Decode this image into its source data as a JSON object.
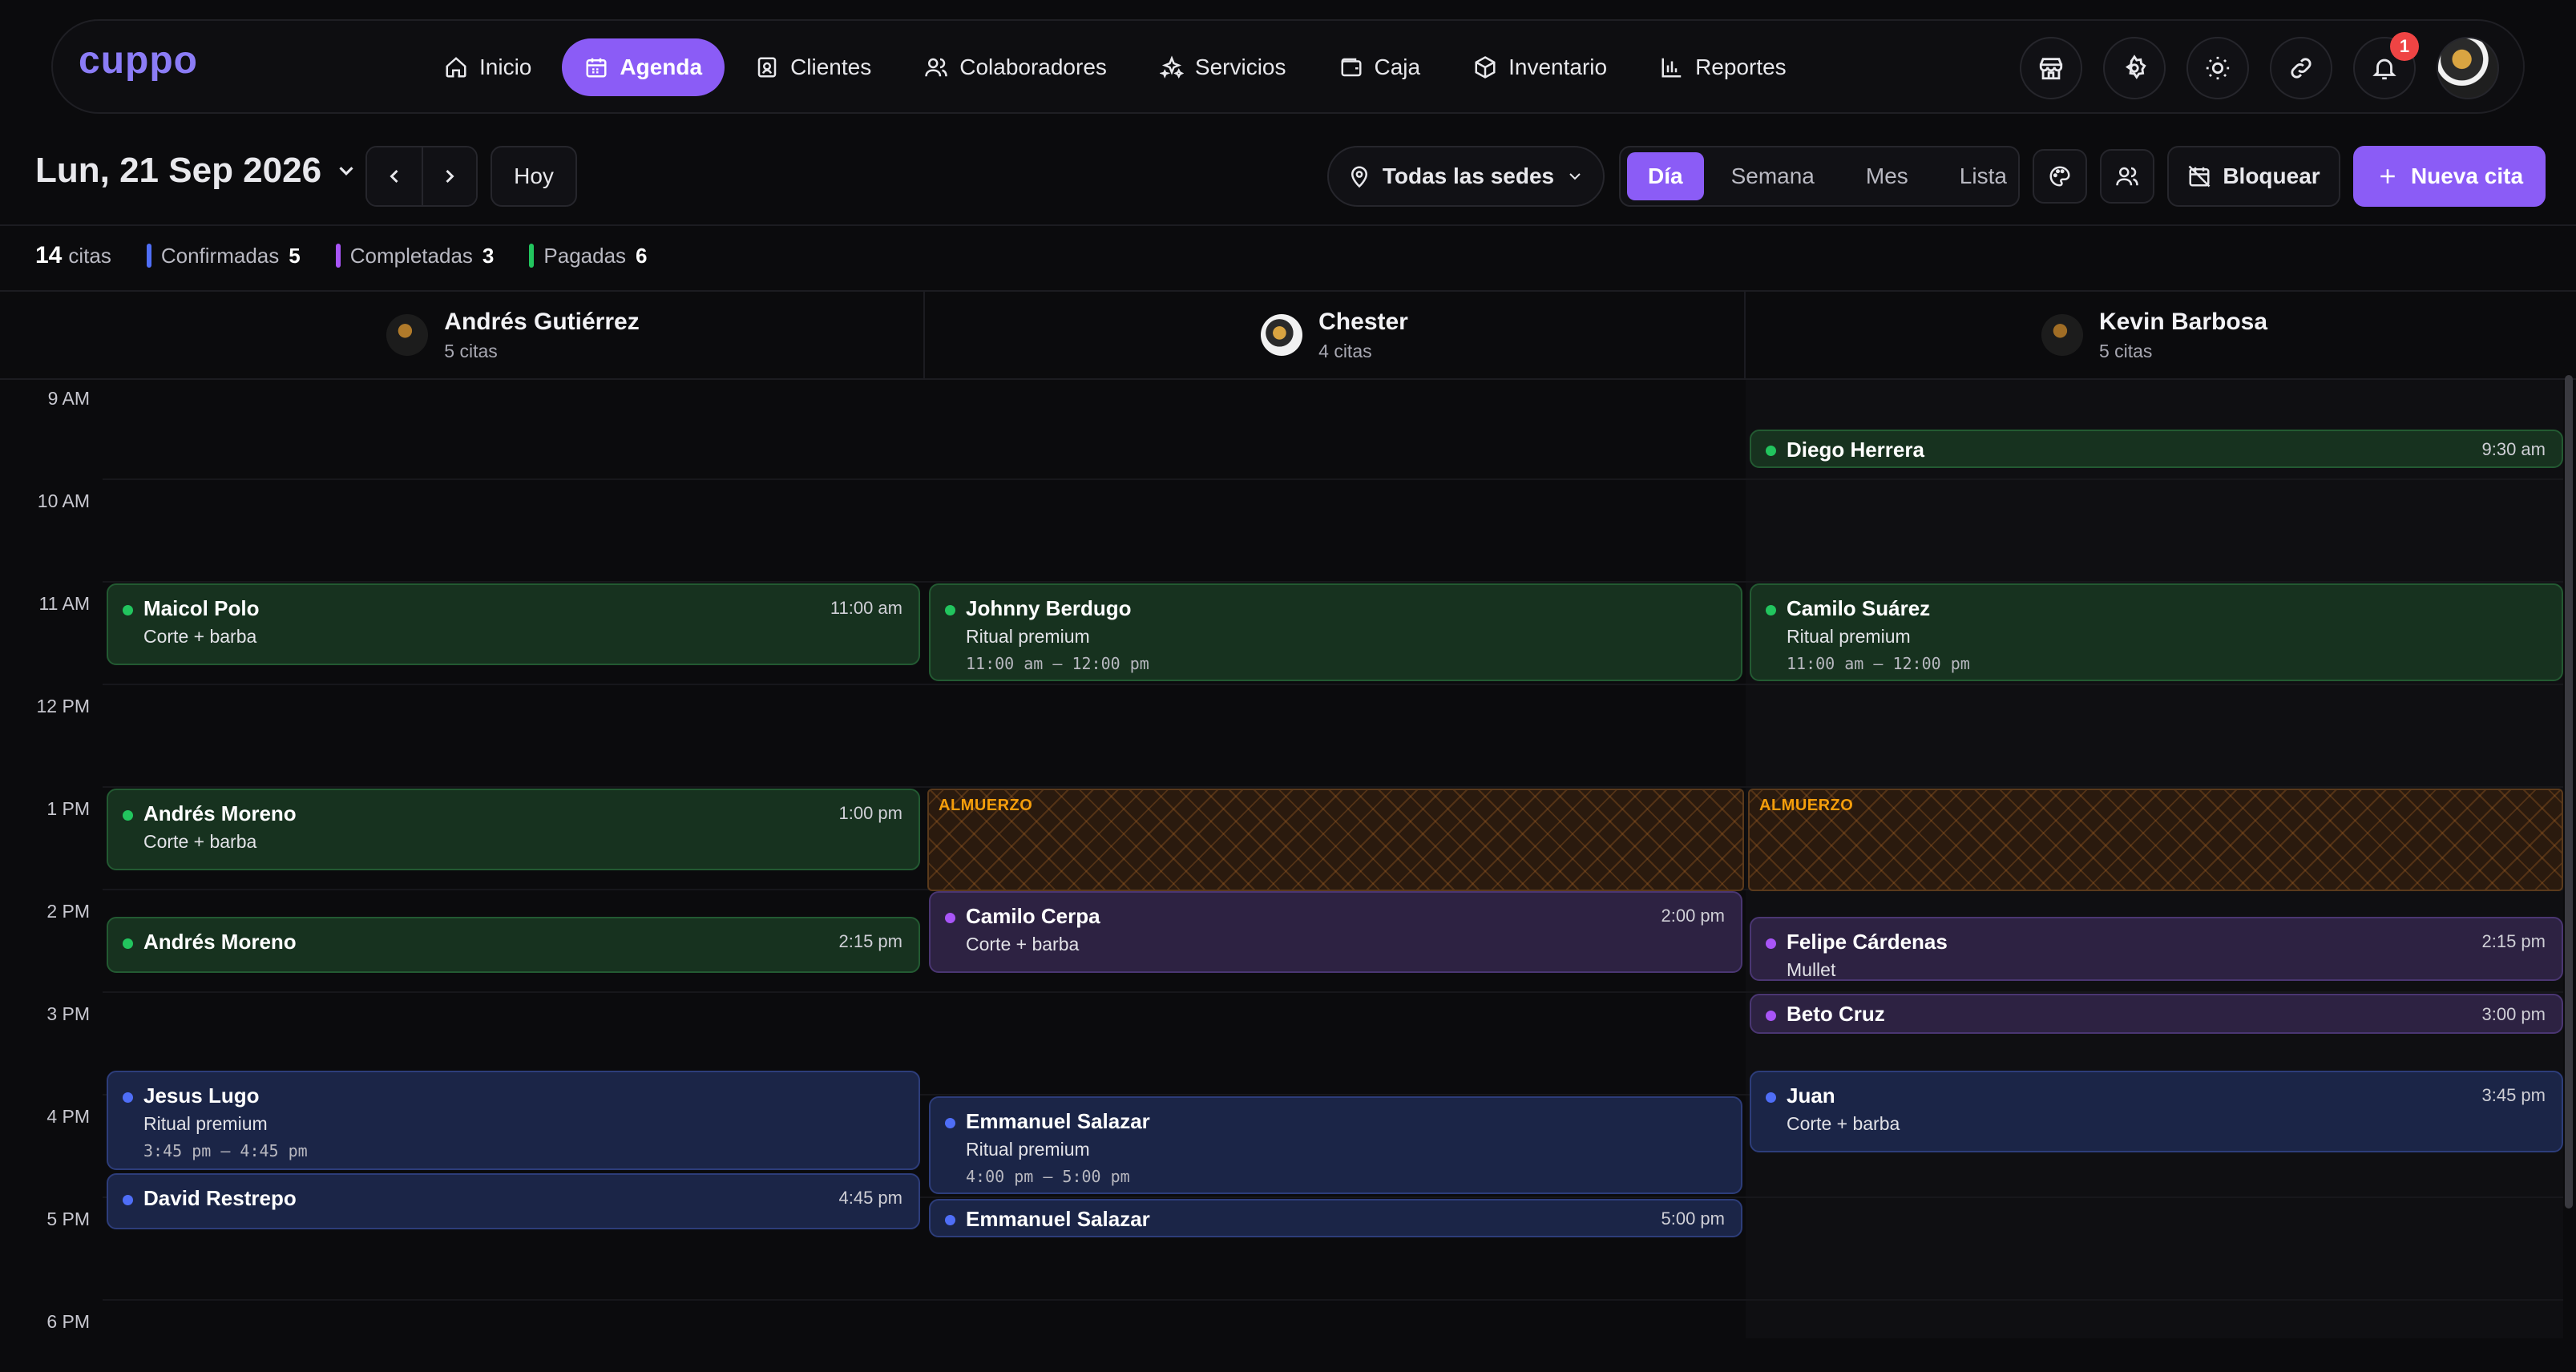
{
  "app": {
    "logo": "cuppo"
  },
  "nav": {
    "items": [
      {
        "label": "Inicio",
        "icon": "home-icon"
      },
      {
        "label": "Agenda",
        "icon": "calendar-icon",
        "active": true
      },
      {
        "label": "Clientes",
        "icon": "contact-icon"
      },
      {
        "label": "Colaboradores",
        "icon": "users-icon"
      },
      {
        "label": "Servicios",
        "icon": "sparkles-icon"
      },
      {
        "label": "Caja",
        "icon": "wallet-icon"
      },
      {
        "label": "Inventario",
        "icon": "box-icon"
      },
      {
        "label": "Reportes",
        "icon": "bar-chart-icon"
      }
    ],
    "notifications_count": "1",
    "accent_color": "#8b5cf6"
  },
  "toolbar": {
    "date": "Lun, 21 Sep 2026",
    "today": "Hoy",
    "location": "Todas las sedes",
    "views": [
      "Día",
      "Semana",
      "Mes",
      "Lista"
    ],
    "active_view": "Día",
    "block": "Bloquear",
    "new_appointment": "Nueva cita"
  },
  "summary": {
    "total": "14",
    "total_label": "citas",
    "items": [
      {
        "label": "Confirmadas",
        "count": "5",
        "color": "#4f6ef7"
      },
      {
        "label": "Completadas",
        "count": "3",
        "color": "#a855f7"
      },
      {
        "label": "Pagadas",
        "count": "6",
        "color": "#22c55e"
      }
    ]
  },
  "columns": [
    {
      "name": "Andrés Gutiérrez",
      "count": "5 citas"
    },
    {
      "name": "Chester",
      "count": "4 citas"
    },
    {
      "name": "Kevin Barbosa",
      "count": "5 citas"
    }
  ],
  "hours": [
    "9 AM",
    "10 AM",
    "11 AM",
    "12 PM",
    "1 PM",
    "2 PM",
    "3 PM",
    "4 PM",
    "5 PM",
    "6 PM"
  ],
  "lunch_label": "ALMUERZO",
  "events": [
    {
      "client": "Maicol Polo",
      "service": "Corte + barba",
      "time": "11:00 am"
    },
    {
      "client": "Andrés Moreno",
      "service": "Corte + barba",
      "time": "1:00 pm"
    },
    {
      "client": "Andrés Moreno",
      "time": "2:15 pm"
    },
    {
      "client": "Jesus Lugo",
      "service": "Ritual premium",
      "range": "3:45 pm – 4:45 pm"
    },
    {
      "client": "David Restrepo",
      "time": "4:45 pm"
    },
    {
      "client": "Johnny Berdugo",
      "service": "Ritual premium",
      "range": "11:00 am – 12:00 pm"
    },
    {
      "client": "Camilo Cerpa",
      "service": "Corte + barba",
      "time": "2:00 pm"
    },
    {
      "client": "Emmanuel Salazar",
      "service": "Ritual premium",
      "range": "4:00 pm – 5:00 pm"
    },
    {
      "client": "Emmanuel Salazar",
      "time": "5:00 pm"
    },
    {
      "client": "Diego Herrera",
      "time": "9:30 am"
    },
    {
      "client": "Camilo Suárez",
      "service": "Ritual premium",
      "range": "11:00 am – 12:00 pm"
    },
    {
      "client": "Felipe Cárdenas",
      "service": "Mullet",
      "time": "2:15 pm"
    },
    {
      "client": "Beto Cruz",
      "time": "3:00 pm"
    },
    {
      "client": "Juan",
      "service": "Corte + barba",
      "time": "3:45 pm"
    }
  ]
}
